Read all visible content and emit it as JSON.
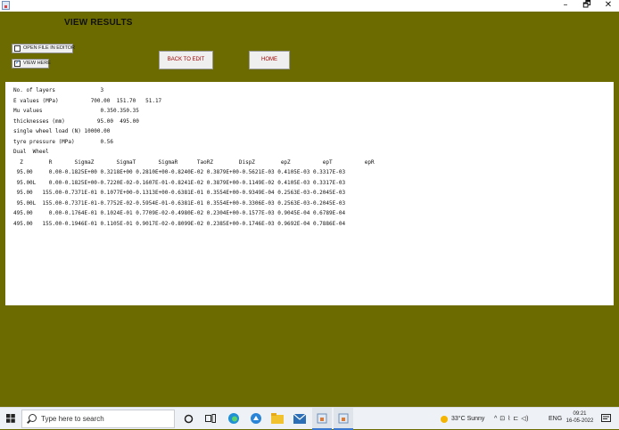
{
  "window": {
    "minimize": "–",
    "maximize": "🗗",
    "close": "✕"
  },
  "app": {
    "heading": "VIEW RESULTS",
    "open_in_editor_label": "OPEN FILE IN EDITOR",
    "open_in_editor_checked": false,
    "view_here_label": "VIEW HERE",
    "view_here_checked": true,
    "back_button": "BACK TO EDIT",
    "home_button": "HOME",
    "results_text": "No. of layers              3\nE values (MPa)          700.00  151.70   51.17\nMu values                  0.350.350.35\nthicknesses (mm)          95.00  495.00\nsingle wheel load (N) 10000.00\ntyre pressure (MPa)        0.56\nDual  Wheel\n  Z        R       SigmaZ       SigmaT       SigmaR      TaoRZ        DispZ        epZ          epT          epR\n 95.00     0.00-0.1825E+00 0.3218E+00 0.2810E+00-0.8240E-02 0.3879E+00-0.5621E-03 0.4105E-03 0.3317E-03\n 95.00L    0.00-0.1825E+00-0.7220E-02-0.1607E-01-0.8241E-02 0.3879E+00-0.1149E-02 0.4105E-03 0.3317E-03\n 95.00   155.00-0.7371E-01 0.1077E+00-0.1313E+00-0.6381E-01 0.3554E+00-0.9349E-04 0.2563E-03-0.2045E-03\n 95.00L  155.00-0.7371E-01-0.7752E-02-0.5954E-01-0.6381E-01 0.3554E+00-0.3306E-03 0.2563E-03-0.2045E-03\n495.00     0.00-0.1764E-01 0.1024E-01 0.7709E-02-0.4980E-02 0.2304E+00-0.1577E-03 0.9045E-04 0.6789E-04\n495.00   155.00-0.1946E-01 0.1105E-01 0.9017E-02-0.8099E-02 0.2385E+00-0.1746E-03 0.9692E-04 0.7886E-04"
  },
  "taskbar": {
    "start_icon": "windows-start-icon",
    "search_placeholder": "Type here to search",
    "weather": "33°C  Sunny",
    "language": "ENG",
    "time": "09:21",
    "date": "16-05-2022",
    "tray_symbols": "^  ⊡  ⌇  ⊏  ◁)  ",
    "notification_badge": "2",
    "app_colors": {
      "edge": "#1f8fd6",
      "explorer": "#f2c12e",
      "mail": "#2d6fb7",
      "java": "#e07a2e"
    }
  }
}
